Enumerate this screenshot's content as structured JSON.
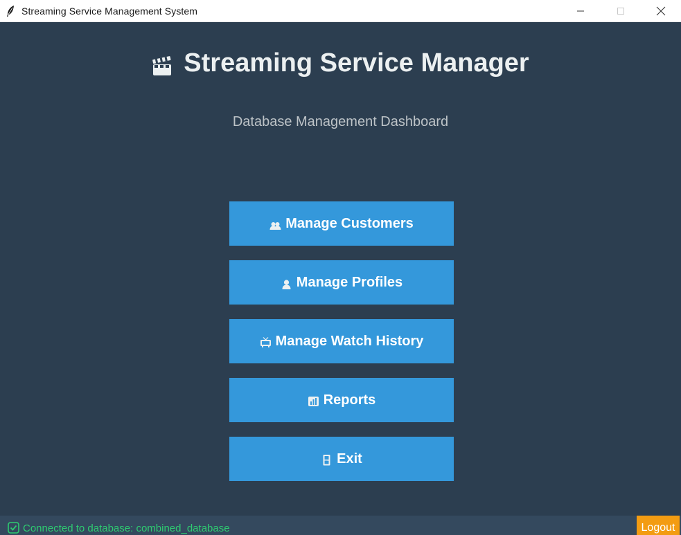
{
  "window": {
    "title": "Streaming Service Management System",
    "app_icon": "feather-icon",
    "controls": [
      "minimize-icon",
      "maximize-icon",
      "close-icon"
    ]
  },
  "header": {
    "icon": "clapperboard-icon",
    "title": "Streaming Service Manager",
    "subtitle": "Database Management Dashboard"
  },
  "menu": [
    {
      "icon": "users-icon",
      "label": "Manage Customers"
    },
    {
      "icon": "user-icon",
      "label": "Manage Profiles"
    },
    {
      "icon": "tv-icon",
      "label": "Manage Watch History"
    },
    {
      "icon": "report-icon",
      "label": "Reports"
    },
    {
      "icon": "door-icon",
      "label": "Exit"
    }
  ],
  "status": {
    "icon": "check-box-icon",
    "text": "Connected to database: combined_database",
    "logout_label": "Logout"
  },
  "colors": {
    "background": "#2c3e50",
    "button": "#3498db",
    "status_bar": "#34495e",
    "status_text": "#2ecc71",
    "logout": "#f39c12"
  }
}
